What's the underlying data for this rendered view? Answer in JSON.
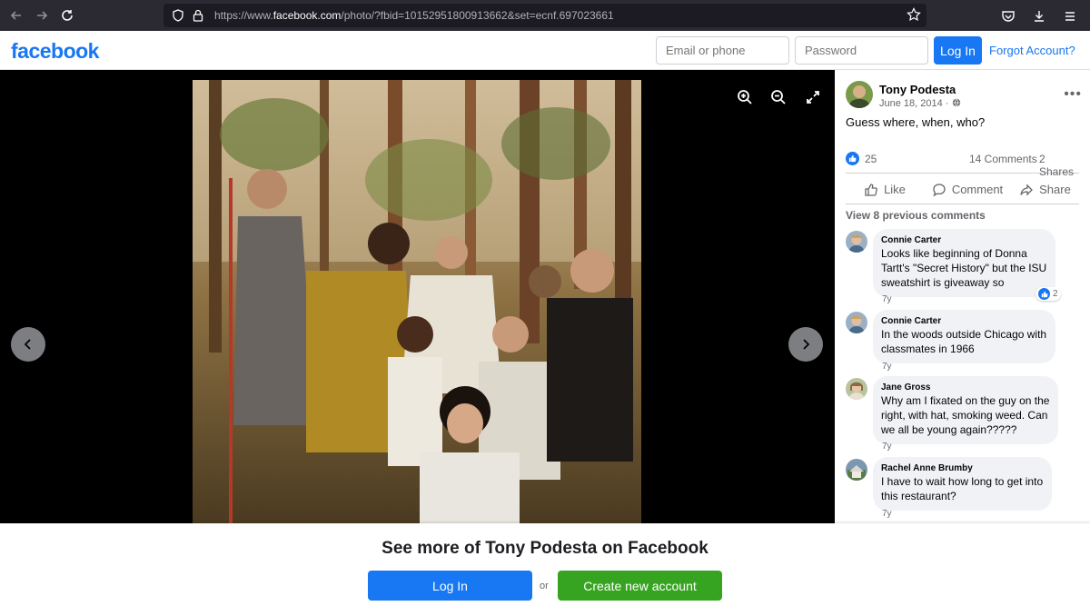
{
  "browser": {
    "url_prefix": "https://www.",
    "url_domain": "facebook.com",
    "url_path": "/photo/?fbid=10152951800913662&set=ecnf.697023661",
    "icons": [
      "back-arrow-icon",
      "forward-arrow-icon",
      "reload-icon",
      "shield-icon",
      "lock-icon",
      "star-icon",
      "pocket-icon",
      "download-icon",
      "menu-icon"
    ]
  },
  "header": {
    "logo": "facebook",
    "email_placeholder": "Email or phone",
    "password_placeholder": "Password",
    "login_label": "Log In",
    "forgot_label": "Forgot Account?"
  },
  "photo_viewer": {
    "tools": [
      "zoom-in-icon",
      "zoom-out-icon",
      "fullscreen-icon"
    ]
  },
  "post": {
    "author": "Tony Podesta",
    "date": "June 18, 2014 ·",
    "caption": "Guess where, when, who?",
    "like_count": "25",
    "comment_count": "14 Comments",
    "share_count": "2 Shares",
    "actions": {
      "like": "Like",
      "comment": "Comment",
      "share": "Share"
    },
    "view_previous": "View 8 previous comments"
  },
  "comments": [
    {
      "name": "Connie Carter",
      "lines": [
        "Looks like beginning of Donna",
        "Tartt's \"Secret History\" but the ISU",
        "sweatshirt is giveaway so"
      ],
      "time": "7y",
      "reactions": "2"
    },
    {
      "name": "Connie Carter",
      "lines": [
        "In the woods outside Chicago with",
        "classmates in 1966"
      ],
      "time": "7y"
    },
    {
      "name": "Jane Gross",
      "lines": [
        "Why am I fixated on the guy on the",
        "right, with hat, smoking weed. Can",
        "we all be young again?????"
      ],
      "time": "7y"
    },
    {
      "name": "Rachel Anne Brumby",
      "lines": [
        "I have to wait how long to get into",
        "this restaurant?"
      ],
      "time": "7y"
    }
  ],
  "bottom": {
    "title": "See more of Tony Podesta on Facebook",
    "login_label": "Log In",
    "or_label": "or",
    "create_label": "Create new account"
  },
  "colors": {
    "brand_blue": "#1877f2",
    "create_green": "#36a420",
    "chrome_bg": "#2b2a33"
  }
}
